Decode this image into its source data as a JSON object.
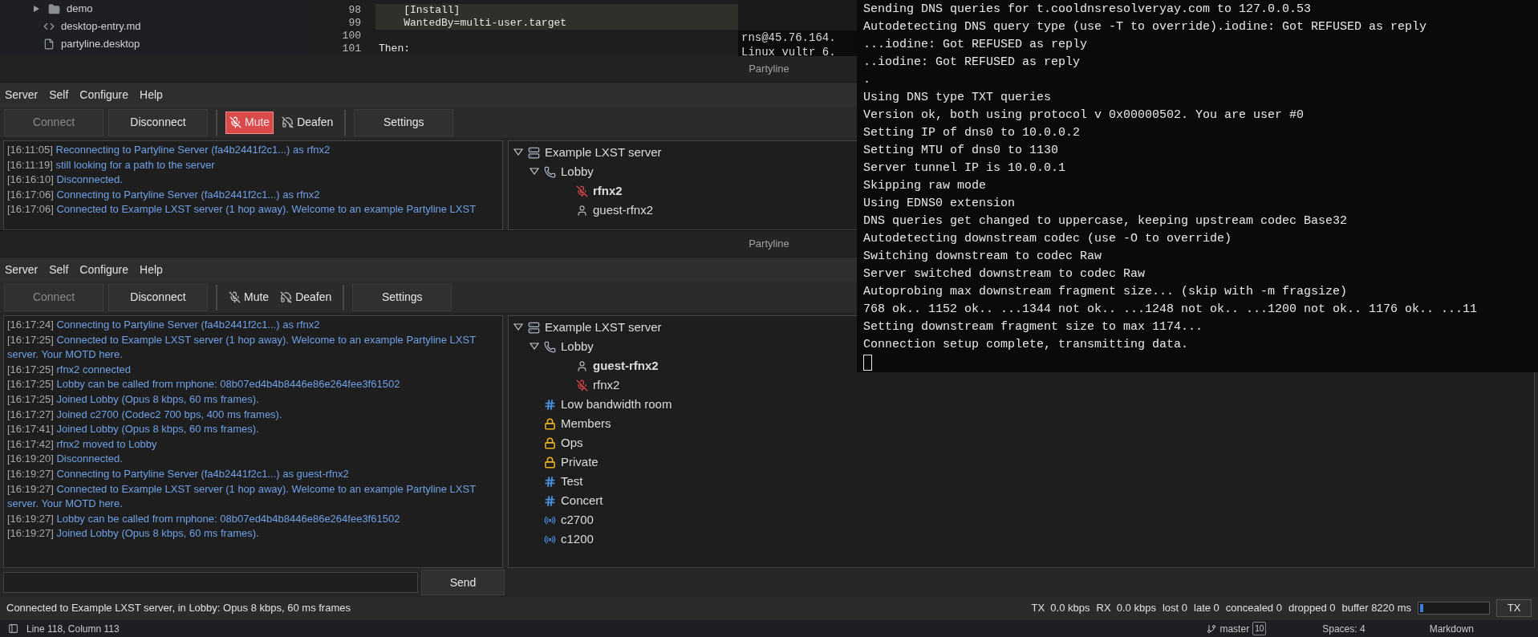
{
  "file_tree": [
    {
      "kind": "folder",
      "name": "demo"
    },
    {
      "kind": "code",
      "name": "desktop-entry.md"
    },
    {
      "kind": "file",
      "name": "partyline.desktop"
    }
  ],
  "editor": {
    "lines": [
      {
        "number": "98",
        "text": "    [Install]",
        "highlighted": true
      },
      {
        "number": "99",
        "text": "    WantedBy=multi-user.target",
        "highlighted": true
      },
      {
        "number": "100",
        "highlighted": false
      },
      {
        "number": "101",
        "text": "Then:",
        "highlighted": false
      }
    ]
  },
  "background_terminal": {
    "lines": [
      "rns@45.76.164.",
      "Linux vultr 6."
    ]
  },
  "windows": [
    {
      "title": "Partyline",
      "menu": [
        "Server",
        "Self",
        "Configure",
        "Help"
      ],
      "toolbar": [
        {
          "kind": "button",
          "label": "Connect",
          "disabled": true
        },
        {
          "kind": "button",
          "label": "Disconnect",
          "disabled": false
        },
        {
          "kind": "mute",
          "label": "Mute",
          "on": true
        },
        {
          "kind": "deafen",
          "label": "Deafen",
          "on": false
        },
        {
          "kind": "button",
          "label": "Settings",
          "disabled": false
        }
      ],
      "log": [
        {
          "time": "[16:11:05]",
          "text": "Reconnecting to Partyline Server (fa4b2441f2c1...) as rfnx2"
        },
        {
          "time": "[16:11:19]",
          "text": "still looking for a path to the server"
        },
        {
          "time": "[16:16:10]",
          "text": "Disconnected."
        },
        {
          "time": "[16:17:06]",
          "text": "Connecting to Partyline Server (fa4b2441f2c1...) as rfnx2"
        },
        {
          "time": "[16:17:06]",
          "text": "Connected to Example LXST server (1 hop away). Welcome to an example Partyline LXST"
        }
      ],
      "tree": [
        {
          "kind": "server",
          "label": "Example LXST server",
          "expanded": true,
          "children": [
            {
              "kind": "lobby",
              "label": "Lobby",
              "expanded": true,
              "children": [
                {
                  "kind": "user",
                  "label": "rfnx2",
                  "self": true,
                  "muted": true
                },
                {
                  "kind": "user",
                  "label": "guest-rfnx2",
                  "self": false,
                  "muted": false
                }
              ]
            }
          ]
        }
      ]
    },
    {
      "title": "Partyline",
      "menu": [
        "Server",
        "Self",
        "Configure",
        "Help"
      ],
      "toolbar": [
        {
          "kind": "button",
          "label": "Connect",
          "disabled": true
        },
        {
          "kind": "button",
          "label": "Disconnect",
          "disabled": false
        },
        {
          "kind": "mute",
          "label": "Mute",
          "on": false
        },
        {
          "kind": "deafen",
          "label": "Deafen",
          "on": false
        },
        {
          "kind": "button",
          "label": "Settings",
          "disabled": false
        }
      ],
      "log": [
        {
          "time": "[16:17:24]",
          "text": "Connecting to Partyline Server (fa4b2441f2c1...) as rfnx2"
        },
        {
          "time": "[16:17:25]",
          "text": "Connected to Example LXST server (1 hop away). Welcome to an example Partyline LXST server. Your MOTD here."
        },
        {
          "time": "[16:17:25]",
          "text": "rfnx2 connected"
        },
        {
          "time": "[16:17:25]",
          "text": "Lobby can be called from rnphone: 08b07ed4b4b8446e86e264fee3f61502"
        },
        {
          "time": "[16:17:25]",
          "text": "Joined Lobby (Opus 8 kbps, 60 ms frames)."
        },
        {
          "time": "[16:17:27]",
          "text": "Joined c2700 (Codec2 700 bps, 400 ms frames)."
        },
        {
          "time": "[16:17:41]",
          "text": "Joined Lobby (Opus 8 kbps, 60 ms frames)."
        },
        {
          "time": "[16:17:42]",
          "text": "rfnx2 moved to Lobby"
        },
        {
          "time": "[16:19:20]",
          "text": "Disconnected."
        },
        {
          "time": "[16:19:27]",
          "text": "Connecting to Partyline Server (fa4b2441f2c1...) as guest-rfnx2"
        },
        {
          "time": "[16:19:27]",
          "text": "Connected to Example LXST server (1 hop away). Welcome to an example Partyline LXST server. Your MOTD here."
        },
        {
          "time": "[16:19:27]",
          "text": "Lobby can be called from rnphone: 08b07ed4b4b8446e86e264fee3f61502"
        },
        {
          "time": "[16:19:27]",
          "text": "Joined Lobby (Opus 8 kbps, 60 ms frames)."
        }
      ],
      "tree": [
        {
          "kind": "server",
          "label": "Example LXST server",
          "expanded": true,
          "children": [
            {
              "kind": "lobby",
              "label": "Lobby",
              "expanded": true,
              "children": [
                {
                  "kind": "user",
                  "label": "guest-rfnx2",
                  "self": true,
                  "muted": false
                },
                {
                  "kind": "user",
                  "label": "rfnx2",
                  "self": false,
                  "muted": true
                }
              ]
            },
            {
              "kind": "channel",
              "label": "Low bandwidth room"
            },
            {
              "kind": "locked",
              "label": "Members"
            },
            {
              "kind": "locked",
              "label": "Ops"
            },
            {
              "kind": "locked",
              "label": "Private"
            },
            {
              "kind": "channel",
              "label": "Test"
            },
            {
              "kind": "channel",
              "label": "Concert"
            },
            {
              "kind": "radio",
              "label": "c2700"
            },
            {
              "kind": "radio",
              "label": "c1200"
            }
          ]
        }
      ],
      "send_button": "Send",
      "status": {
        "text": "Connected to Example LXST server, in Lobby: Opus 8 kbps, 60 ms frames",
        "stats": [
          "TX  0.0 kbps",
          "RX  0.0 kbps",
          "lost 0",
          "late 0",
          "concealed 0",
          "dropped 0",
          "buffer 8220 ms"
        ],
        "meter": {
          "level": 0.05
        },
        "tx_button": "TX"
      }
    }
  ],
  "terminal": {
    "lines": [
      "Sending DNS queries for t.cooldnsresolveryay.com to 127.0.0.53",
      "Autodetecting DNS query type (use -T to override).iodine: Got REFUSED as reply",
      "...iodine: Got REFUSED as reply",
      "..iodine: Got REFUSED as reply",
      ".",
      "Using DNS type TXT queries",
      "Version ok, both using protocol v 0x00000502. You are user #0",
      "Setting IP of dns0 to 10.0.0.2",
      "Setting MTU of dns0 to 1130",
      "Server tunnel IP is 10.0.0.1",
      "Skipping raw mode",
      "Using EDNS0 extension",
      "DNS queries get changed to uppercase, keeping upstream codec Base32",
      "Autodetecting downstream codec (use -O to override)",
      "Switching downstream to codec Raw",
      "Server switched downstream to codec Raw",
      "Autoprobing max downstream fragment size... (skip with -m fragsize)",
      "768 ok.. 1152 ok.. ...1344 not ok.. ...1248 not ok.. ...1200 not ok.. 1176 ok.. ...11",
      "Setting downstream fragment size to max 1174...",
      "Connection setup complete, transmitting data."
    ],
    "cursor": true
  },
  "editor_status": {
    "position": "Line 118, Column 113",
    "branch": "master",
    "badge": "10",
    "indent": "Spaces: 4",
    "language": "Markdown"
  }
}
